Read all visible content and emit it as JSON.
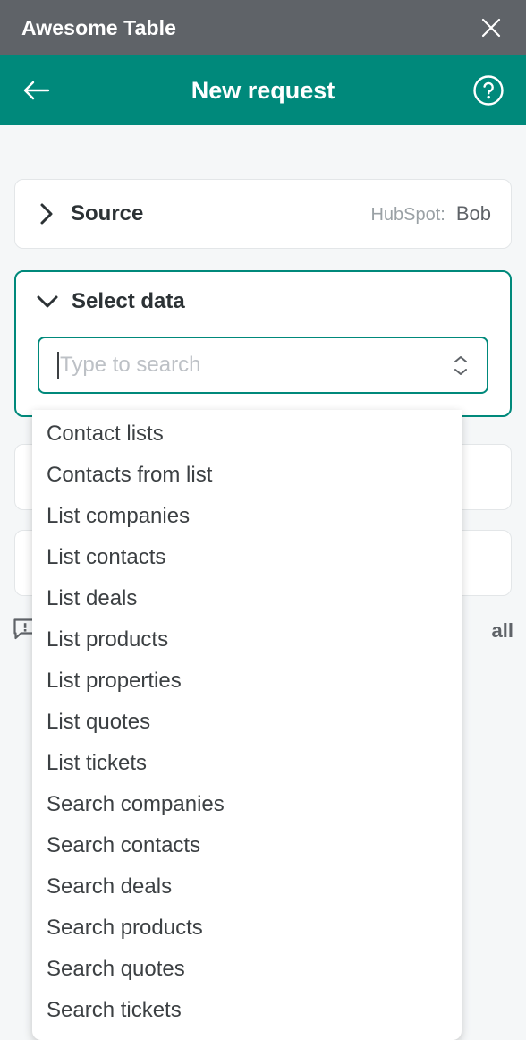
{
  "titlebar": {
    "app_title": "Awesome Table",
    "close_icon": "close-icon"
  },
  "appbar": {
    "back_icon": "arrow-left-icon",
    "title": "New request",
    "help_icon": "help-circle-icon",
    "accent_color": "#00897b"
  },
  "sections": {
    "source": {
      "title": "Source",
      "chevron": "chevron-right-icon",
      "summary_label": "HubSpot:",
      "summary_value": "Bob",
      "expanded": false
    },
    "select_data": {
      "title": "Select data",
      "chevron": "chevron-down-icon",
      "expanded": true,
      "search": {
        "value": "",
        "placeholder": "Type to search",
        "stepper_icon": "chevron-up-down-icon"
      }
    }
  },
  "dropdown": {
    "options": [
      "Contact lists",
      "Contacts from list",
      "List companies",
      "List contacts",
      "List deals",
      "List products",
      "List properties",
      "List quotes",
      "List tickets",
      "Search companies",
      "Search contacts",
      "Search deals",
      "Search products",
      "Search quotes",
      "Search tickets"
    ]
  },
  "footer": {
    "feedback_icon": "feedback-bubble-icon",
    "link_label": "all"
  }
}
